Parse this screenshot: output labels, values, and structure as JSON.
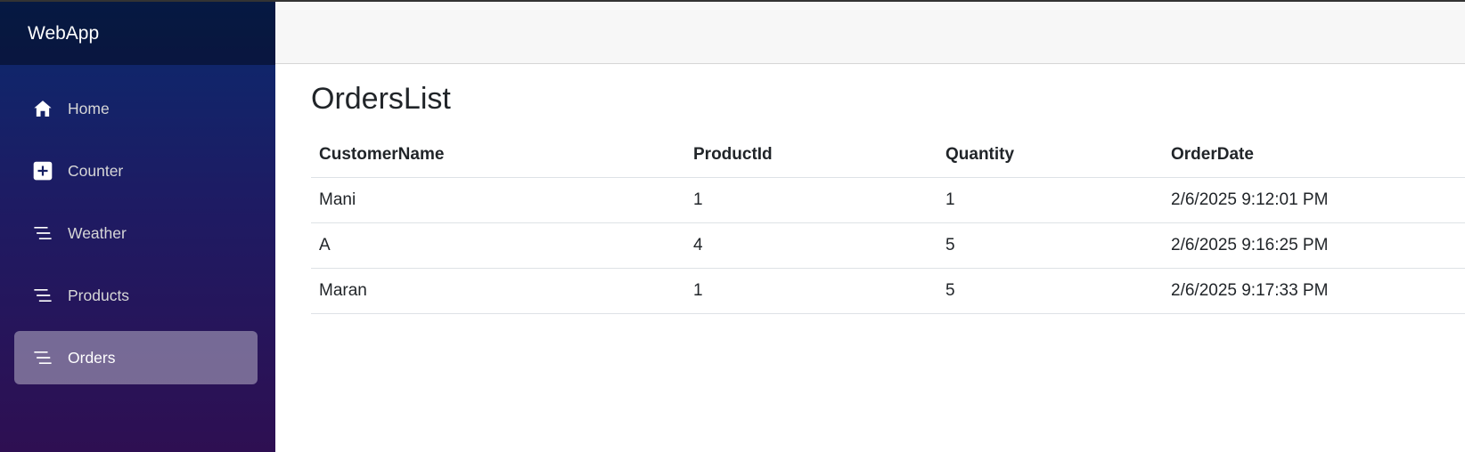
{
  "app": {
    "brand": "WebApp"
  },
  "sidebar": {
    "items": [
      {
        "label": "Home",
        "icon": "house-icon",
        "active": false
      },
      {
        "label": "Counter",
        "icon": "plus-square-icon",
        "active": false
      },
      {
        "label": "Weather",
        "icon": "list-icon",
        "active": false
      },
      {
        "label": "Products",
        "icon": "list-icon",
        "active": false
      },
      {
        "label": "Orders",
        "icon": "list-icon",
        "active": true
      }
    ]
  },
  "main": {
    "title": "OrdersList",
    "table": {
      "columns": [
        "CustomerName",
        "ProductId",
        "Quantity",
        "OrderDate"
      ],
      "rows": [
        [
          "Mani",
          "1",
          "1",
          "2/6/2025 9:12:01 PM"
        ],
        [
          "A",
          "4",
          "5",
          "2/6/2025 9:16:25 PM"
        ],
        [
          "Maran",
          "1",
          "5",
          "2/6/2025 9:17:33 PM"
        ]
      ]
    }
  },
  "colors": {
    "sidebar_top": "#0a2a6e",
    "sidebar_bottom": "#2e0f52",
    "active_item_bg": "#7a6a96",
    "top_row_bg": "#f7f7f7"
  }
}
